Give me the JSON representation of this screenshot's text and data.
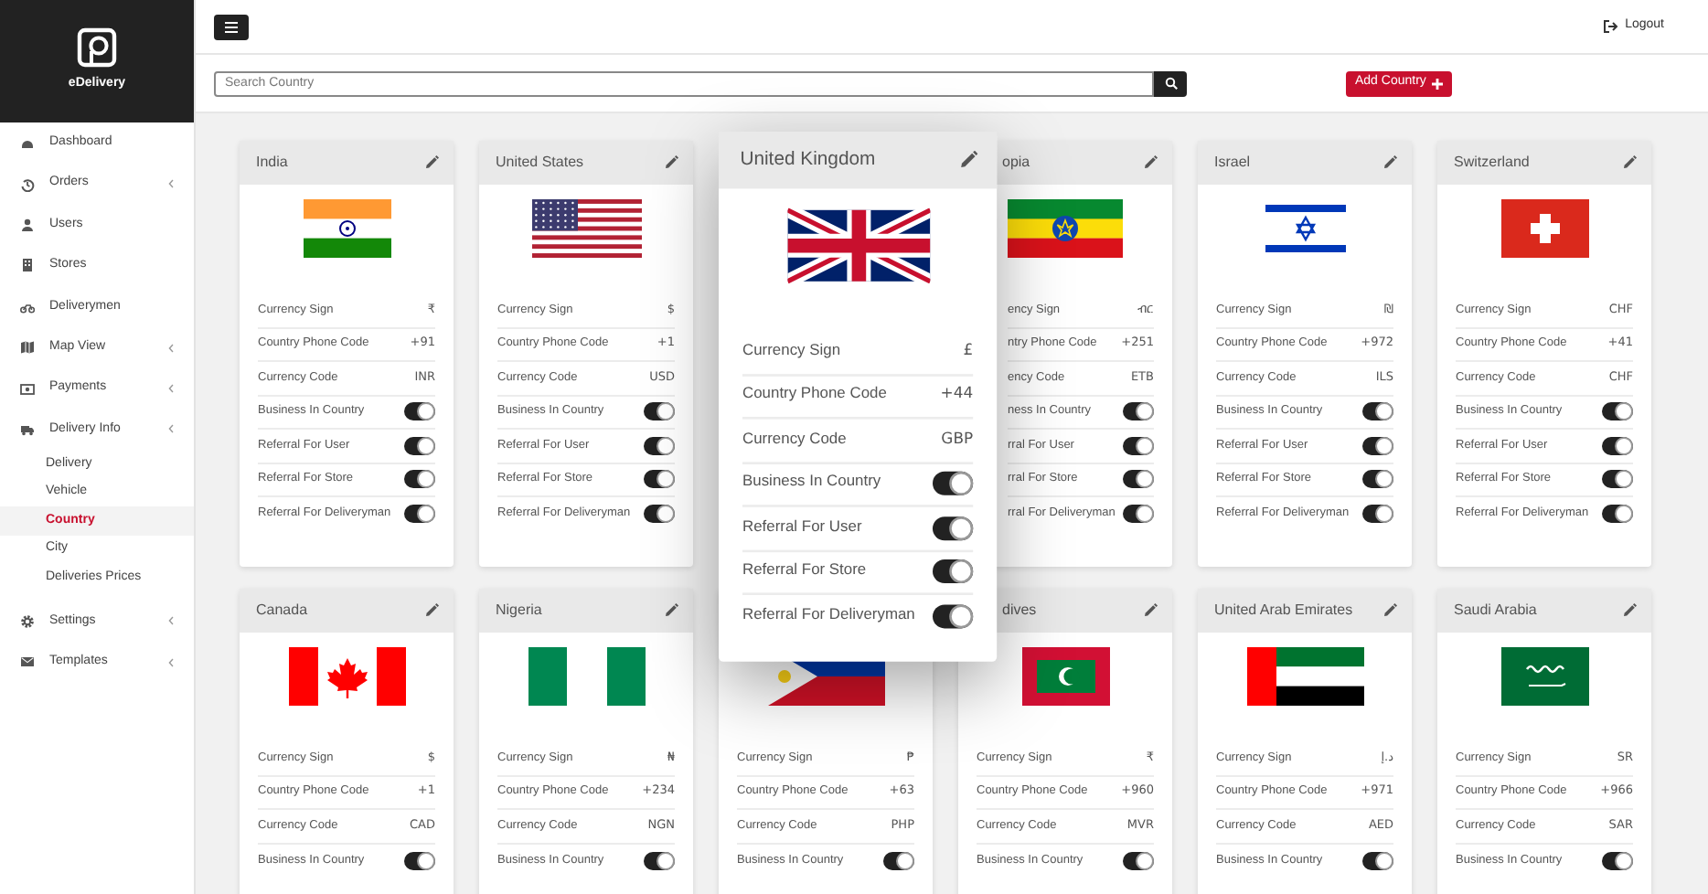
{
  "brand": {
    "name": "eDelivery"
  },
  "sidebar": {
    "items": [
      {
        "label": "Dashboard",
        "expandable": false
      },
      {
        "label": "Orders",
        "expandable": true
      },
      {
        "label": "Users",
        "expandable": false
      },
      {
        "label": "Stores",
        "expandable": false
      },
      {
        "label": "Deliverymen",
        "expandable": false
      },
      {
        "label": "Map View",
        "expandable": true
      },
      {
        "label": "Payments",
        "expandable": true
      },
      {
        "label": "Delivery Info",
        "expandable": true,
        "children": [
          {
            "label": "Delivery",
            "selected": false
          },
          {
            "label": "Vehicle",
            "selected": false
          },
          {
            "label": "Country",
            "selected": true
          },
          {
            "label": "City",
            "selected": false
          },
          {
            "label": "Deliveries Prices",
            "selected": false
          }
        ]
      },
      {
        "label": "Settings",
        "expandable": true
      },
      {
        "label": "Templates",
        "expandable": true
      }
    ]
  },
  "topbar": {
    "logout": "Logout"
  },
  "search": {
    "placeholder": "Search Country"
  },
  "add_button": "Add Country",
  "cards": [
    {
      "title": "India",
      "kind": "india",
      "raised": false,
      "title_covered": false,
      "rows_covered": false,
      "rows": [
        {
          "kind": "value",
          "label": "Currency Sign",
          "value": "₹"
        },
        {
          "kind": "value",
          "label": "Country Phone Code",
          "value": "+91"
        },
        {
          "kind": "value",
          "label": "Currency Code",
          "value": "INR"
        },
        {
          "kind": "toggle",
          "label": "Business In Country",
          "on": true
        },
        {
          "kind": "toggle",
          "label": "Referral For User",
          "on": true
        },
        {
          "kind": "toggle",
          "label": "Referral For Store",
          "on": true
        },
        {
          "kind": "toggle",
          "label": "Referral For Deliveryman",
          "on": true
        }
      ]
    },
    {
      "title": "United States",
      "kind": "usa",
      "raised": false,
      "title_covered": false,
      "rows_covered": false,
      "rows": [
        {
          "kind": "value",
          "label": "Currency Sign",
          "value": "$"
        },
        {
          "kind": "value",
          "label": "Country Phone Code",
          "value": "+1"
        },
        {
          "kind": "value",
          "label": "Currency Code",
          "value": "USD"
        },
        {
          "kind": "toggle",
          "label": "Business In Country",
          "on": true
        },
        {
          "kind": "toggle",
          "label": "Referral For User",
          "on": true
        },
        {
          "kind": "toggle",
          "label": "Referral For Store",
          "on": true
        },
        {
          "kind": "toggle",
          "label": "Referral For Deliveryman",
          "on": true
        }
      ]
    },
    {
      "title": "United Kingdom",
      "kind": "uk",
      "raised": true,
      "title_covered": false,
      "rows_covered": false,
      "rows": [
        {
          "kind": "value",
          "label": "Currency Sign",
          "value": "£"
        },
        {
          "kind": "value",
          "label": "Country Phone Code",
          "value": "+44"
        },
        {
          "kind": "value",
          "label": "Currency Code",
          "value": "GBP"
        },
        {
          "kind": "toggle",
          "label": "Business In Country",
          "on": true
        },
        {
          "kind": "toggle",
          "label": "Referral For User",
          "on": true
        },
        {
          "kind": "toggle",
          "label": "Referral For Store",
          "on": true
        },
        {
          "kind": "toggle",
          "label": "Referral For Deliveryman",
          "on": true
        }
      ]
    },
    {
      "title": "opia",
      "kind": "ethiopia",
      "raised": false,
      "title_covered": true,
      "rows_covered": true,
      "rows": [
        {
          "kind": "value",
          "label": "ency Sign",
          "value": "ብር"
        },
        {
          "kind": "value",
          "label": "ntry Phone Code",
          "value": "+251"
        },
        {
          "kind": "value",
          "label": "ency Code",
          "value": "ETB"
        },
        {
          "kind": "toggle",
          "label": "ness In Country",
          "on": true
        },
        {
          "kind": "toggle",
          "label": "rral For User",
          "on": true
        },
        {
          "kind": "toggle",
          "label": "rral For Store",
          "on": true
        },
        {
          "kind": "toggle",
          "label": "rral For Deliveryman",
          "on": true
        }
      ]
    },
    {
      "title": "Israel",
      "kind": "israel",
      "raised": false,
      "title_covered": false,
      "rows_covered": false,
      "rows": [
        {
          "kind": "value",
          "label": "Currency Sign",
          "value": "₪"
        },
        {
          "kind": "value",
          "label": "Country Phone Code",
          "value": "+972"
        },
        {
          "kind": "value",
          "label": "Currency Code",
          "value": "ILS"
        },
        {
          "kind": "toggle",
          "label": "Business In Country",
          "on": true
        },
        {
          "kind": "toggle",
          "label": "Referral For User",
          "on": true
        },
        {
          "kind": "toggle",
          "label": "Referral For Store",
          "on": true
        },
        {
          "kind": "toggle",
          "label": "Referral For Deliveryman",
          "on": true
        }
      ]
    },
    {
      "title": "Switzerland",
      "kind": "switzerland",
      "raised": false,
      "title_covered": false,
      "rows_covered": false,
      "rows": [
        {
          "kind": "value",
          "label": "Currency Sign",
          "value": "CHF"
        },
        {
          "kind": "value",
          "label": "Country Phone Code",
          "value": "+41"
        },
        {
          "kind": "value",
          "label": "Currency Code",
          "value": "CHF"
        },
        {
          "kind": "toggle",
          "label": "Business In Country",
          "on": true
        },
        {
          "kind": "toggle",
          "label": "Referral For User",
          "on": true
        },
        {
          "kind": "toggle",
          "label": "Referral For Store",
          "on": true
        },
        {
          "kind": "toggle",
          "label": "Referral For Deliveryman",
          "on": true
        }
      ]
    },
    {
      "title": "Canada",
      "kind": "canada",
      "raised": false,
      "title_covered": false,
      "rows_covered": false,
      "rows": [
        {
          "kind": "value",
          "label": "Currency Sign",
          "value": "$"
        },
        {
          "kind": "value",
          "label": "Country Phone Code",
          "value": "+1"
        },
        {
          "kind": "value",
          "label": "Currency Code",
          "value": "CAD"
        },
        {
          "kind": "toggle",
          "label": "Business In Country",
          "on": true
        }
      ]
    },
    {
      "title": "Nigeria",
      "kind": "nigeria",
      "raised": false,
      "title_covered": false,
      "rows_covered": false,
      "rows": [
        {
          "kind": "value",
          "label": "Currency Sign",
          "value": "₦"
        },
        {
          "kind": "value",
          "label": "Country Phone Code",
          "value": "+234"
        },
        {
          "kind": "value",
          "label": "Currency Code",
          "value": "NGN"
        },
        {
          "kind": "toggle",
          "label": "Business In Country",
          "on": true
        }
      ]
    },
    {
      "kind": "philippines",
      "raised": false,
      "title_covered": false,
      "rows_covered": false,
      "rows": [
        {
          "kind": "value",
          "label": "Currency Sign",
          "value": "₱"
        },
        {
          "kind": "value",
          "label": "Country Phone Code",
          "value": "+63"
        },
        {
          "kind": "value",
          "label": "Currency Code",
          "value": "PHP"
        },
        {
          "kind": "toggle",
          "label": "Business In Country",
          "on": true
        }
      ]
    },
    {
      "title": "dives",
      "kind": "maldives",
      "raised": false,
      "title_covered": true,
      "rows_covered": false,
      "rows": [
        {
          "kind": "value",
          "label": "Currency Sign",
          "value": "₹"
        },
        {
          "kind": "value",
          "label": "Country Phone Code",
          "value": "+960"
        },
        {
          "kind": "value",
          "label": "Currency Code",
          "value": "MVR"
        },
        {
          "kind": "toggle",
          "label": "Business In Country",
          "on": true
        }
      ]
    },
    {
      "title": "United Arab Emirates",
      "kind": "uae",
      "raised": false,
      "title_covered": false,
      "rows_covered": false,
      "rows": [
        {
          "kind": "value",
          "label": "Currency Sign",
          "value": "د.إ"
        },
        {
          "kind": "value",
          "label": "Country Phone Code",
          "value": "+971"
        },
        {
          "kind": "value",
          "label": "Currency Code",
          "value": "AED"
        },
        {
          "kind": "toggle",
          "label": "Business In Country",
          "on": true
        }
      ]
    },
    {
      "title": "Saudi Arabia",
      "kind": "saudi",
      "raised": false,
      "title_covered": false,
      "rows_covered": false,
      "rows": [
        {
          "kind": "value",
          "label": "Currency Sign",
          "value": "SR"
        },
        {
          "kind": "value",
          "label": "Country Phone Code",
          "value": "+966"
        },
        {
          "kind": "value",
          "label": "Currency Code",
          "value": "SAR"
        },
        {
          "kind": "toggle",
          "label": "Business In Country",
          "on": true
        }
      ]
    }
  ]
}
